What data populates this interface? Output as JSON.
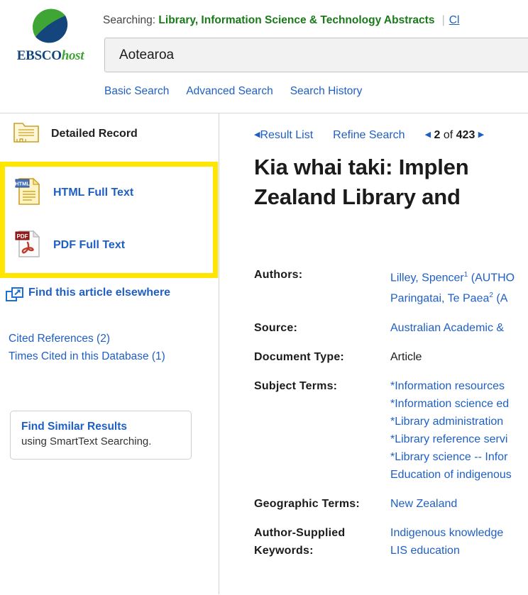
{
  "header": {
    "logo_text_primary": "EBSCO",
    "logo_text_secondary": "host",
    "searching_label": "Searching:",
    "database_name": "Library, Information Science & Technology Abstracts",
    "choose_databases_label": "Cl",
    "search_value": "Aotearoa",
    "search_placeholder": "",
    "modes": [
      {
        "label": "Basic Search"
      },
      {
        "label": "Advanced Search"
      },
      {
        "label": "Search History"
      }
    ]
  },
  "sidebar": {
    "detailed_record_label": "Detailed Record",
    "html_full_text_label": "HTML Full Text",
    "pdf_full_text_label": "PDF Full Text",
    "html_icon_badge": "HTML",
    "pdf_icon_badge": "PDF",
    "find_elsewhere_label": "Find this article elsewhere",
    "cited_references_label": "Cited References (2)",
    "times_cited_label": "Times Cited in this Database (1)",
    "smarttext_title": "Find Similar Results",
    "smarttext_sub": "using SmartText Searching.",
    "highlight_color": "#ffe600"
  },
  "main": {
    "result_list_label": "Result List",
    "refine_search_label": "Refine Search",
    "pager_current": "2",
    "pager_of": "of",
    "pager_total": "423",
    "prev_caret": "◀",
    "next_caret": "▶",
    "title_line1": "Kia whai taki: Implen",
    "title_line2": "Zealand Library and",
    "fields": [
      {
        "label": "Authors:",
        "type": "links",
        "values": [
          {
            "text": "Lilley, Spencer",
            "sup": "1",
            "suffix": " (AUTHO"
          },
          {
            "text": "Paringatai, Te Paea",
            "sup": "2",
            "suffix": " (A"
          }
        ]
      },
      {
        "label": "Source:",
        "type": "links",
        "values": [
          {
            "text": "Australian Academic & ",
            "sup": "",
            "suffix": ""
          }
        ]
      },
      {
        "label": "Document Type:",
        "type": "plain",
        "values": [
          {
            "text": "Article",
            "sup": "",
            "suffix": ""
          }
        ]
      },
      {
        "label": "Subject Terms:",
        "type": "links",
        "values": [
          {
            "text": "*Information resources ",
            "sup": "",
            "suffix": ""
          },
          {
            "text": "*Information science ed",
            "sup": "",
            "suffix": ""
          },
          {
            "text": "*Library administration",
            "sup": "",
            "suffix": ""
          },
          {
            "text": "*Library reference servi",
            "sup": "",
            "suffix": ""
          },
          {
            "text": "*Library science -- Infor",
            "sup": "",
            "suffix": ""
          },
          {
            "text": "Education of indigenous",
            "sup": "",
            "suffix": ""
          }
        ]
      },
      {
        "label": "Geographic Terms:",
        "type": "links",
        "values": [
          {
            "text": "New Zealand",
            "sup": "",
            "suffix": ""
          }
        ]
      },
      {
        "label": "Author-Supplied Keywords:",
        "type": "links",
        "values": [
          {
            "text": "Indigenous knowledge",
            "sup": "",
            "suffix": ""
          },
          {
            "text": "LIS education",
            "sup": "",
            "suffix": ""
          }
        ]
      }
    ]
  }
}
